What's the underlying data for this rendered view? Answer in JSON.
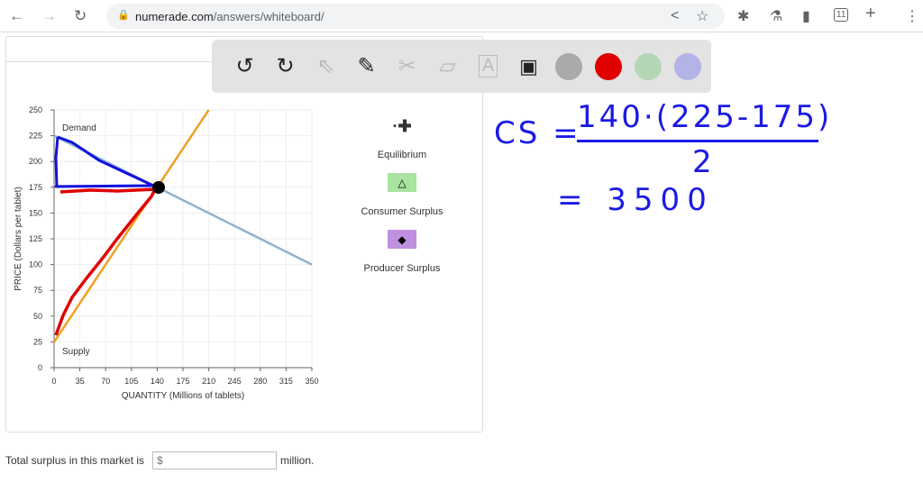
{
  "browser": {
    "url_domain": "numerade.com",
    "url_path": "/answers/whiteboard/",
    "tab_count": "11"
  },
  "toolbar": {
    "colors": [
      "#aaaaaa",
      "#e00000",
      "#b5d6b5",
      "#b3b3e6"
    ]
  },
  "chart_data": {
    "type": "line",
    "xlabel": "QUANTITY (Millions of tablets)",
    "ylabel": "PRICE (Dollars per tablet)",
    "xlim": [
      0,
      350
    ],
    "ylim": [
      0,
      250
    ],
    "xticks": [
      0,
      35,
      70,
      105,
      140,
      175,
      210,
      245,
      280,
      315,
      350
    ],
    "yticks": [
      0,
      25,
      50,
      75,
      100,
      125,
      150,
      175,
      200,
      225,
      250
    ],
    "grid": true,
    "series": [
      {
        "name": "Demand",
        "color": "#8fb1d0",
        "points": [
          [
            0,
            225
          ],
          [
            350,
            100
          ]
        ]
      },
      {
        "name": "Supply",
        "color": "#f0a020",
        "points": [
          [
            0,
            25
          ],
          [
            210,
            250
          ]
        ]
      }
    ],
    "equilibrium": [
      140,
      175
    ],
    "legend": [
      "Equilibrium",
      "Consumer Surplus",
      "Producer Surplus"
    ],
    "legend_colors": {
      "consumer": "#a9e3a0",
      "producer": "#c18fe0"
    }
  },
  "question": {
    "prefix": "Total surplus in this market is",
    "placeholder": "$",
    "suffix": "million."
  },
  "handwriting": {
    "line1": "CS =",
    "numerator": "140·(225-175)",
    "denominator": "2",
    "line2": "= 3500"
  }
}
